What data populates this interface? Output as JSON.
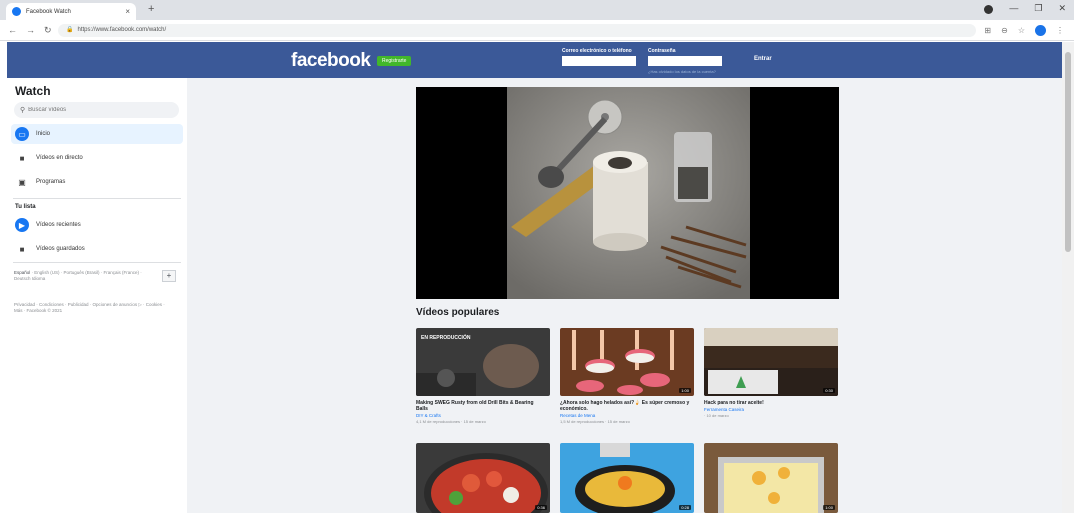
{
  "browser": {
    "tab_title": "Facebook Watch",
    "tab_close": "×",
    "new_tab": "+",
    "url": "https://www.facebook.com/watch/",
    "window_controls": [
      "—",
      "❐",
      "✕"
    ]
  },
  "header": {
    "logo": "facebook",
    "signup_label": "Registrarte",
    "email_label": "Correo electrónico o teléfono",
    "password_label": "Contraseña",
    "forgot_link": "¿Has olvidado los datos de la cuenta?",
    "login_label": "Entrar",
    "brand_color": "#3b5998"
  },
  "sidebar": {
    "title": "Watch",
    "search_placeholder": "Buscar vídeos",
    "items": [
      {
        "label": "Inicio",
        "icon": "home-icon"
      },
      {
        "label": "Vídeos en directo",
        "icon": "live-video-icon"
      },
      {
        "label": "Programas",
        "icon": "shows-icon"
      }
    ],
    "section_title": "Tu lista",
    "list_items": [
      {
        "label": "Vídeos recientes",
        "icon": "play-icon"
      },
      {
        "label": "Vídeos guardados",
        "icon": "bookmark-icon"
      }
    ],
    "languages_current": "Español",
    "languages_rest": "· English (US) · Português (Brasil) · Français (France) · Deutsch",
    "languages_more": "Idioma",
    "add_language": "+",
    "footer": "Privacidad · Condiciones · Publicidad · Opciones de anuncios ▷ · Cookies · Más · Facebook © 2021"
  },
  "main": {
    "popular_title": "Vídeos populares",
    "videos": [
      {
        "title": "Making SWEG Rusty from old Drill Bits & Bearing Balls",
        "page": "DIY & Crafts",
        "meta": "4,1 M de reproducciones · 15 de marzo",
        "duration": "",
        "live_label": "EN REPRODUCCIÓN"
      },
      {
        "title": "¿Ahora solo hago helados así?🍦 Es súper cremoso y económico.",
        "page": "Recetas de Mena",
        "meta": "1,5 M de reproducciones · 15 de marzo",
        "duration": "1:00"
      },
      {
        "title": "Hack para no tirar aceite!",
        "page": "Ferramenta Caseira",
        "meta": "· 10 de marzo",
        "duration": "0:30"
      },
      {
        "duration": "0:36"
      },
      {
        "duration": "0:28"
      },
      {
        "duration": "1:00"
      }
    ]
  }
}
